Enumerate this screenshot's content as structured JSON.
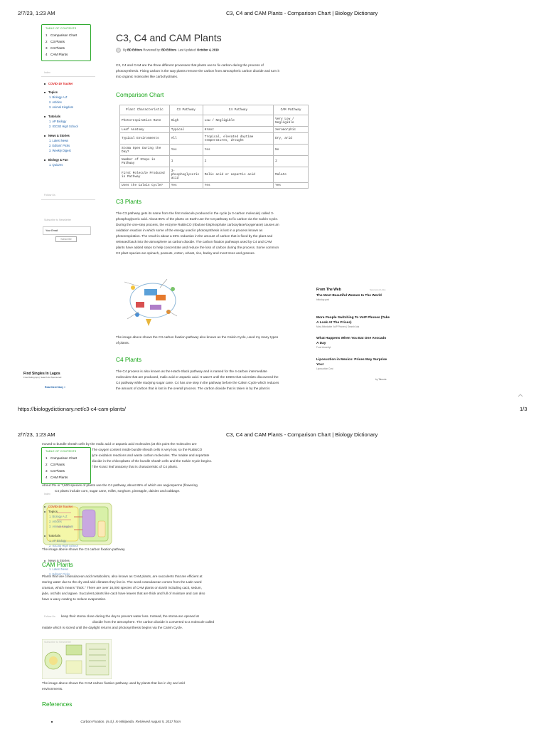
{
  "page1": {
    "header": {
      "datetime": "2/7/23, 1:23 AM",
      "doc_title": "C3, C4 and CAM Plants - Comparison Chart | Biology Dictionary"
    },
    "toc": {
      "label": "TABLE OF CONTENTS",
      "items": [
        {
          "num": "1",
          "label": "Comparison Chart"
        },
        {
          "num": "2",
          "label": "C3 Plants"
        },
        {
          "num": "3",
          "label": "C4 Plants"
        },
        {
          "num": "4",
          "label": "CAM Plants"
        }
      ]
    },
    "sidebar": {
      "index_label": "Index",
      "groups": [
        {
          "head": "COVID-19 Tracker",
          "accent": true,
          "subs": []
        },
        {
          "head": "Topics",
          "accent": false,
          "subs": [
            "1. Biology A-Z",
            "2. Articles",
            "3. Animal Kingdom"
          ]
        },
        {
          "head": "Tutorials",
          "accent": false,
          "subs": [
            "1. AP Biology",
            "2. IGCSE High School"
          ]
        },
        {
          "head": "News & Stories",
          "accent": false,
          "subs": [
            "1. Latest News",
            "2. Editors' Picks",
            "3. Weekly Digest"
          ]
        },
        {
          "head": "Biology & Fun",
          "accent": false,
          "subs": [
            "1. Quizzes"
          ]
        }
      ],
      "follow_label": "Follow Us",
      "newsletter_label": "Subscribe to Newsletter",
      "email_placeholder": "Your Email",
      "subscribe_button": "Subscribe"
    },
    "article": {
      "title": "C3, C4 and CAM Plants",
      "byline_by": "By",
      "author": "BD Editors",
      "reviewed_prefix": "Reviewed by:",
      "reviewer": "BD Editors",
      "updated_prefix": "Last Updated:",
      "updated": "October 4, 2019",
      "intro_lines": [
        "C3, C4 and CAM are the three different processes that plants use to fix carbon during the process of",
        "photosynthesis. Fixing carbon is the way plants remove the carbon from atmospheric carbon dioxide and turn it",
        "into organic molecules like carbohydrates."
      ],
      "comparison_heading": "Comparison Chart",
      "table": {
        "headers": [
          "Plant Characteristic",
          "C3 Pathway",
          "C4 Pathway",
          "CAM Pathway"
        ],
        "rows": [
          [
            "Photorespiration Rate",
            "High",
            "Low / Negligible",
            "Very Low / Negligible"
          ],
          [
            "Leaf Anatomy",
            "Typical",
            "Kranz",
            "Xeromorphic"
          ],
          [
            "Typical Environments",
            "All",
            "Tropical, elevated daytime temperatures, drought",
            "Dry, arid"
          ],
          [
            "Stoma Open During the Day?",
            "Yes",
            "Yes",
            "No"
          ],
          [
            "Number of Steps in Pathway",
            "1",
            "2",
            "2"
          ],
          [
            "First Molecule Produced in Pathway",
            "3-phosphoglyceric acid",
            "Malic acid or aspartic acid",
            "Malate"
          ],
          [
            "Uses the Calvin Cycle?",
            "Yes",
            "Yes",
            "Yes"
          ]
        ]
      },
      "c3_heading": "C3 Plants",
      "c3_lines": [
        "The C3 pathway gets its name from the first molecule produced in the cycle (a 3-carbon molecule) called 3-",
        "phosphoglyceric acid. About 85% of the plants on Earth use the C3 pathway to fix carbon via the Calvin Cycle.",
        "During the one-step process, the enzyme RuBisCO (ribulose bisphosphate carboxylase/oxygenase) causes an",
        "oxidation reaction in which some of the energy used in photosynthesis is lost in a process known as",
        "photorespiration. The result is about a 25% reduction in the amount of carbon that is fixed by the plant and",
        "released back into the atmosphere as carbon dioxide. The carbon fixation pathways used by C4 and CAM",
        "plants have added steps to help concentrate and reduce the loss of carbon during the process. Some common",
        "C3 plant species are spinach, peanuts, cotton, wheat, rice, barley and most trees and grasses."
      ],
      "c3_caption_lines": [
        "The image above shows the C3 carbon fixation pathway also known as the Calvin Cycle, used my many types",
        "of plants."
      ],
      "c4_heading": "C4 Plants",
      "c4_lines": [
        "The C4 process is also known as the Hatch-Slack pathway and is named for the 4-carbon intermediate",
        "molecules that are produced, malic acid or aspartic acid. It wasn't until the 1960s that scientists discovered the",
        "C4 pathway while studying sugar cane. C4 has one step in the pathway before the Calvin Cycle which reduces",
        "the amount of carbon that is lost in the overall process. The carbon dioxide that is taken in by the plant is"
      ]
    },
    "ads": {
      "from_web": "From The Web",
      "sponsored": "Sponsored Links",
      "items": [
        {
          "title": "The Most Beautiful Women In The World",
          "source": "bdtoday.post"
        },
        {
          "title": "More People Switching To VoIP Phones (Take A Look At The Prices)",
          "source": "Most Affordable VoIP Phones | Search Ads"
        },
        {
          "title": "What Happens When You Eat One Avocado A Day",
          "source": "Food Amentiyt"
        },
        {
          "title": "Liposuction in Mexico: Prices May Surprise You!",
          "source": "Liposuction Cost"
        }
      ],
      "by": "by Taboola",
      "left_ad": {
        "title": "Find Singles In Lagos",
        "source": "Free Dating App | Search Ad Sponsored",
        "cta": "Read Next Story »"
      }
    },
    "footer": {
      "url": "https://biologydictionary.net/c3-c4-cam-plants/",
      "page": "1/3"
    }
  },
  "page2": {
    "header": {
      "datetime": "2/7/23, 1:23 AM",
      "doc_title": "C3, C4 and CAM Plants - Comparison Chart | Biology Dictionary"
    },
    "c4_cont_lines": [
      "moved to bundle sheath cells by the malic acid or aspartic acid molecules (at this point the molecules are",
      "The oxygen content inside bundle sheath cells is very low, so the RuBisCO",
      "lyze oxidation reactions and waste carbon molecules. The malate and aspartate",
      "dioxide in the chloroplasts of the bundle sheath cells and the Calvin Cycle begins.",
      "f the Kranz leaf anatomy that is characteristic of C4 plants."
    ],
    "c4_stats_lines": [
      "About 3% or 7,600 species of plants use the C4 pathway, about 85% of which are angiosperms (flowering",
      "C4 plants include corn, sugar cane, millet, sorghum, pineapple, daisies and cabbage."
    ],
    "c4_caption": "The image above shows the C4 carbon fixation pathway.",
    "cam_heading": "CAM Plants",
    "cam_lines": [
      "Plants that use crassulacean acid metabolism, also known as CAM plants, are succulents that are efficient at",
      "storing water due to the dry and arid climates they live in. The word crassulacean comes from the Latin word",
      "crassus, which means \"thick.\" There are over 16,000 species of CAM plants on Earth including cacti, sedum,",
      "jade, orchids and agave. Succulent plants like cacti have leaves that are thick and full of moisture and can also",
      "have a waxy coating to reduce evaporation."
    ],
    "cam_lines2": [
      "keep their stoma close during the day to prevent water loss. Instead, the stoma are opened at",
      "dioxide from the atmosphere. The carbon dioxide is converted to a molecule called",
      "malate which is stored until the daylight returns and photosynthesis begins via the Calvin Cycle."
    ],
    "cam_caption_lines": [
      "The image above shows the CAM carbon fixation pathway used by plants that live in dry and arid",
      "environments."
    ],
    "references_heading": "References",
    "reference_line": "Carbon Fixation. (n.d.). In Wikipedia. Retrieved August 5, 2017 from"
  }
}
